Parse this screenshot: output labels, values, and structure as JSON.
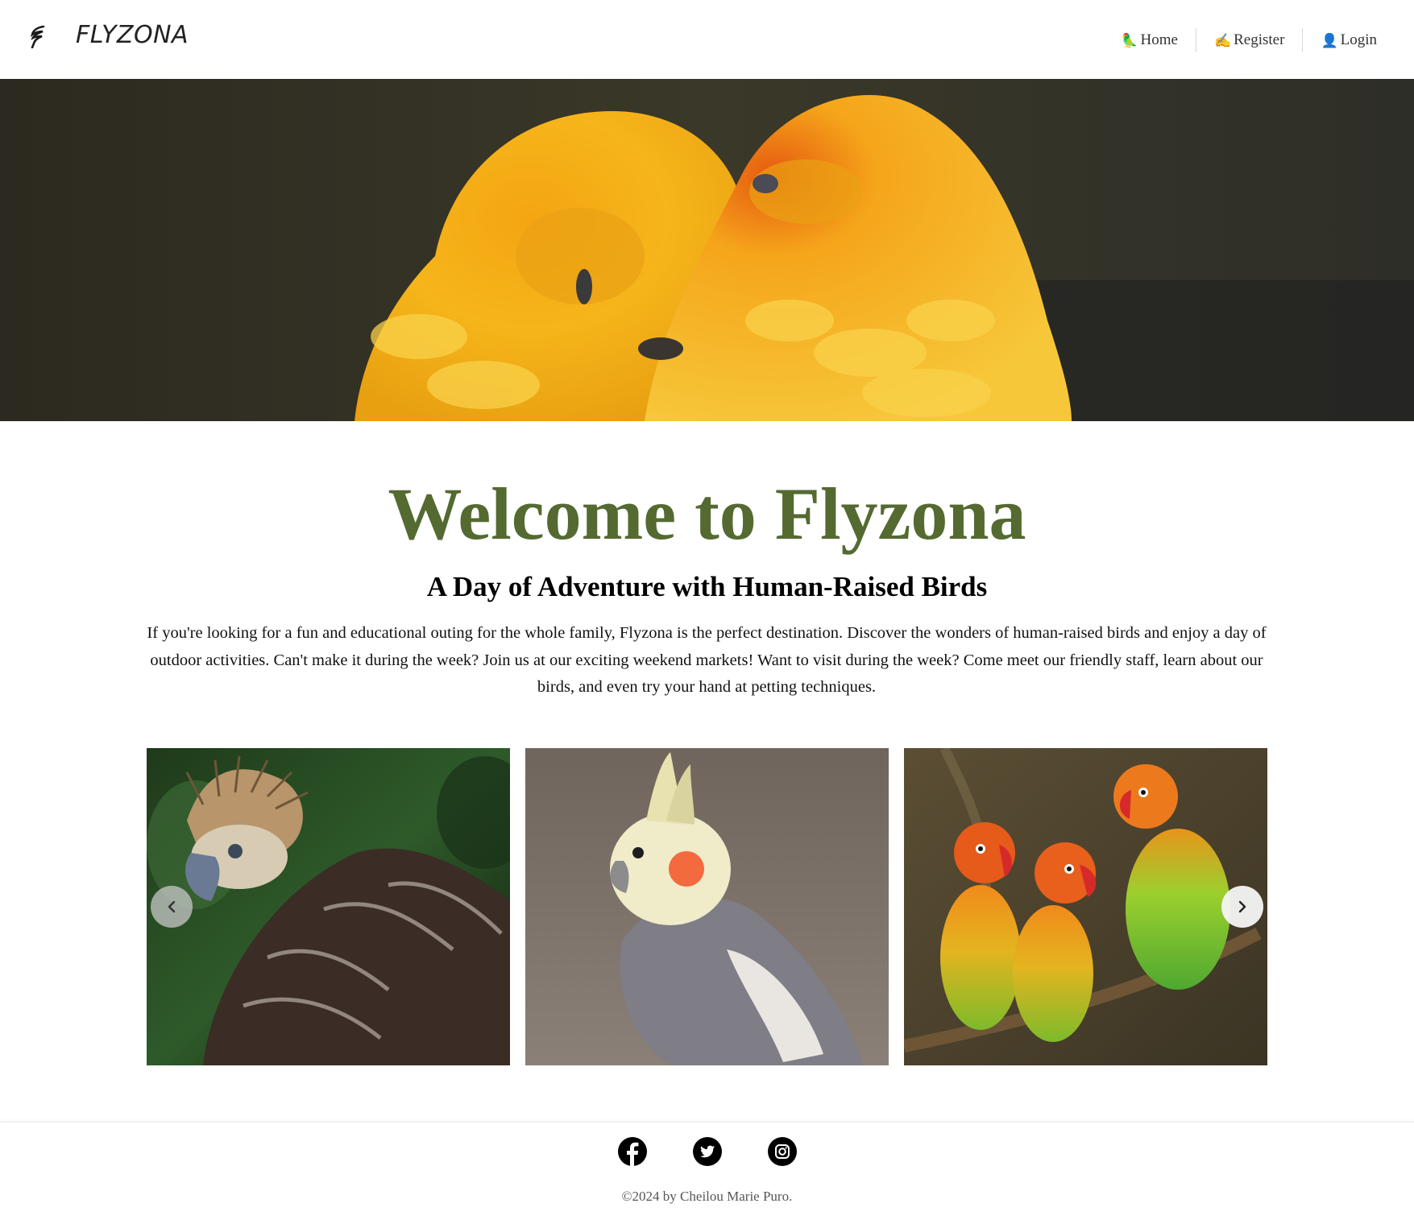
{
  "header": {
    "brand": "FLYZONA",
    "logo_icon": "feather-icon",
    "nav": [
      {
        "label": "Home",
        "icon": "bird-emoji-icon"
      },
      {
        "label": "Register",
        "icon": "writing-hand-emoji-icon"
      },
      {
        "label": "Login",
        "icon": "user-silhouette-emoji-icon"
      }
    ]
  },
  "hero": {
    "image": "two yellow sun conure parrots cuddling"
  },
  "main": {
    "title": "Welcome to Flyzona",
    "subtitle": "A Day of Adventure with Human-Raised Birds",
    "description": "If you're looking for a fun and educational outing for the whole family, Flyzona is the perfect destination. Discover the wonders of human-raised birds and enjoy a day of outdoor activities. Can't make it during the week? Join us at our exciting weekend markets! Want to visit during the week? Come meet our friendly staff, learn about our birds, and even try your hand at petting techniques.",
    "title_color": "#546a31"
  },
  "carousel": {
    "slides": [
      {
        "image": "philippine eagle"
      },
      {
        "image": "grey cockatiel"
      },
      {
        "image": "three lovebirds on branch"
      }
    ],
    "prev_icon": "chevron-left-icon",
    "next_icon": "chevron-right-icon"
  },
  "footer": {
    "socials": [
      "facebook-icon",
      "twitter-icon",
      "instagram-icon"
    ],
    "copyright": "©2024 by Cheilou Marie Puro."
  }
}
